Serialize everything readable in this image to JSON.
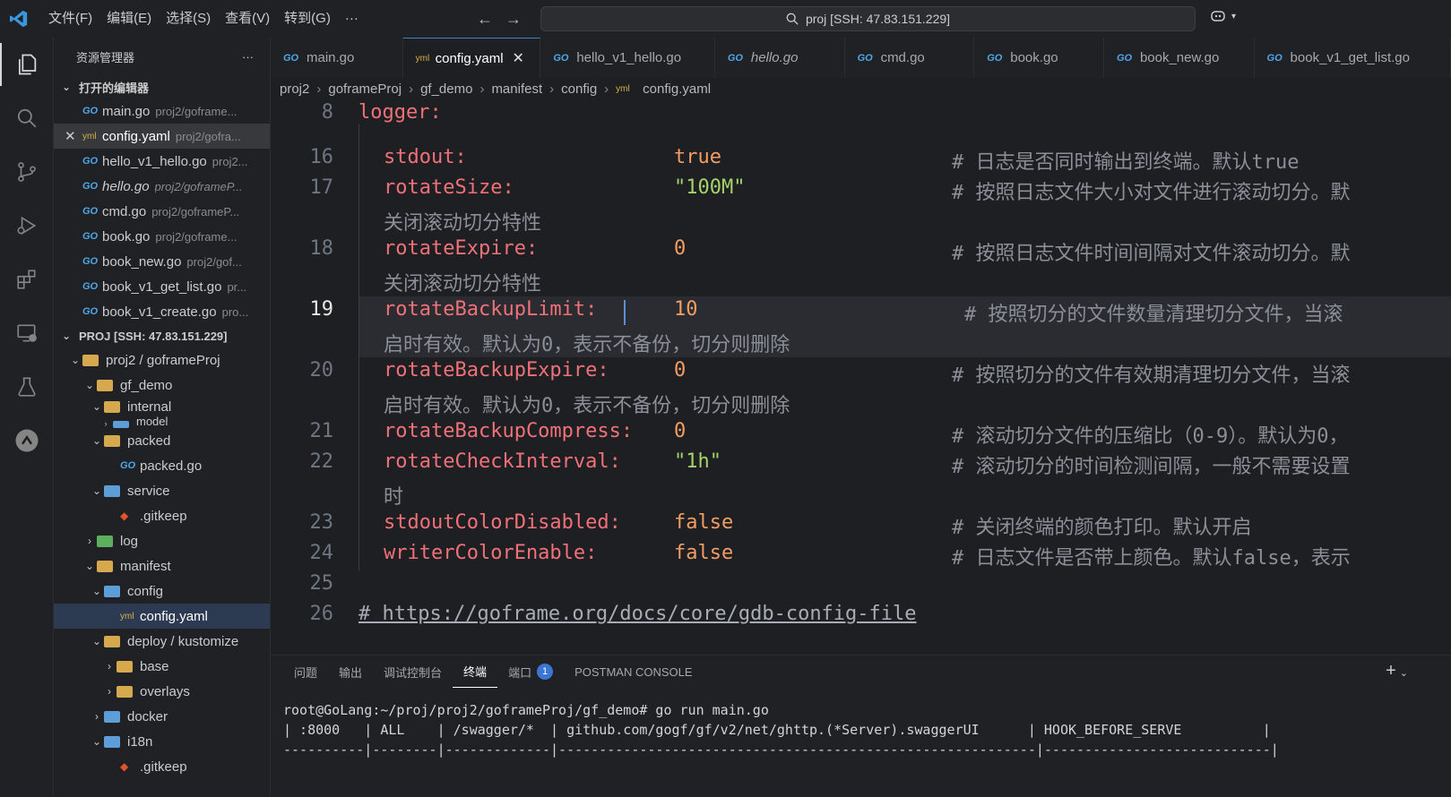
{
  "menu": [
    "文件(F)",
    "编辑(E)",
    "选择(S)",
    "查看(V)",
    "转到(G)",
    "···"
  ],
  "command_center": "proj [SSH: 47.83.151.229]",
  "sidebar": {
    "title": "资源管理器",
    "more": "···",
    "open_editors_title": "打开的编辑器",
    "open_editors": [
      {
        "name": "main.go",
        "path": "proj2/goframe..."
      },
      {
        "name": "config.yaml",
        "path": "proj2/gofra..."
      },
      {
        "name": "hello_v1_hello.go",
        "path": "proj2..."
      },
      {
        "name": "hello.go",
        "path": "proj2/goframeP..."
      },
      {
        "name": "cmd.go",
        "path": "proj2/goframeP..."
      },
      {
        "name": "book.go",
        "path": "proj2/goframe..."
      },
      {
        "name": "book_new.go",
        "path": "proj2/gof..."
      },
      {
        "name": "book_v1_get_list.go",
        "path": "pr..."
      },
      {
        "name": "book_v1_create.go",
        "path": "pro..."
      }
    ],
    "project_title": "PROJ [SSH: 47.83.151.229]",
    "tree": {
      "root": "proj2 / goframeProj",
      "gf_demo": "gf_demo",
      "internal": "internal",
      "model": "model",
      "packed": "packed",
      "packed_go": "packed.go",
      "service": "service",
      "gitkeep1": ".gitkeep",
      "log": "log",
      "manifest": "manifest",
      "config": "config",
      "config_yaml": "config.yaml",
      "deploy": "deploy / kustomize",
      "base": "base",
      "overlays": "overlays",
      "docker": "docker",
      "i18n": "i18n",
      "gitkeep2": ".gitkeep"
    }
  },
  "tabs": [
    "main.go",
    "config.yaml",
    "hello_v1_hello.go",
    "hello.go",
    "cmd.go",
    "book.go",
    "book_new.go",
    "book_v1_get_list.go"
  ],
  "breadcrumb": [
    "proj2",
    "goframeProj",
    "gf_demo",
    "manifest",
    "config",
    "config.yaml"
  ],
  "code": {
    "l8": {
      "n": "8",
      "key": "logger:"
    },
    "l16": {
      "n": "16",
      "key": "stdout:",
      "val": "true",
      "cmt": "# 日志是否同时输出到终端。默认true"
    },
    "l17": {
      "n": "17",
      "key": "rotateSize:",
      "val": "\"100M\"",
      "cmt": "# 按照日志文件大小对文件进行滚动切分。默",
      "wrap": "关闭滚动切分特性"
    },
    "l18": {
      "n": "18",
      "key": "rotateExpire:",
      "val": "0",
      "cmt": "# 按照日志文件时间间隔对文件滚动切分。默",
      "wrap": "关闭滚动切分特性"
    },
    "l19": {
      "n": "19",
      "key": "rotateBackupLimit:",
      "val": "10",
      "cmt": "# 按照切分的文件数量清理切分文件，当滚",
      "wrap": "启时有效。默认为0，表示不备份，切分则删除"
    },
    "l20": {
      "n": "20",
      "key": "rotateBackupExpire:",
      "val": "0",
      "cmt": "# 按照切分的文件有效期清理切分文件，当滚",
      "wrap": "启时有效。默认为0，表示不备份，切分则删除"
    },
    "l21": {
      "n": "21",
      "key": "rotateBackupCompress:",
      "val": "0",
      "cmt": "# 滚动切分文件的压缩比（0-9）。默认为0，"
    },
    "l22": {
      "n": "22",
      "key": "rotateCheckInterval:",
      "val": "\"1h\"",
      "cmt": "# 滚动切分的时间检测间隔，一般不需要设置",
      "wrap": "时"
    },
    "l23": {
      "n": "23",
      "key": "stdoutColorDisabled:",
      "val": "false",
      "cmt": "# 关闭终端的颜色打印。默认开启"
    },
    "l24": {
      "n": "24",
      "key": "writerColorEnable:",
      "val": "false",
      "cmt": "# 日志文件是否带上颜色。默认false，表示"
    },
    "l25": {
      "n": "25"
    },
    "l26": {
      "n": "26",
      "cmt": "# https://goframe.org/docs/core/gdb-config-file"
    }
  },
  "panel": {
    "tabs": [
      "问题",
      "输出",
      "调试控制台",
      "终端",
      "端口",
      "POSTMAN CONSOLE"
    ],
    "ports_badge": "1",
    "terminal": [
      "root@GoLang:~/proj/proj2/goframeProj/gf_demo# go run main.go",
      "| :8000   | ALL    | /swagger/*  | github.com/gogf/gf/v2/net/ghttp.(*Server).swaggerUI      | HOOK_BEFORE_SERVE          |",
      "----------|--------|-------------|-----------------------------------------------------------|----------------------------|"
    ]
  }
}
